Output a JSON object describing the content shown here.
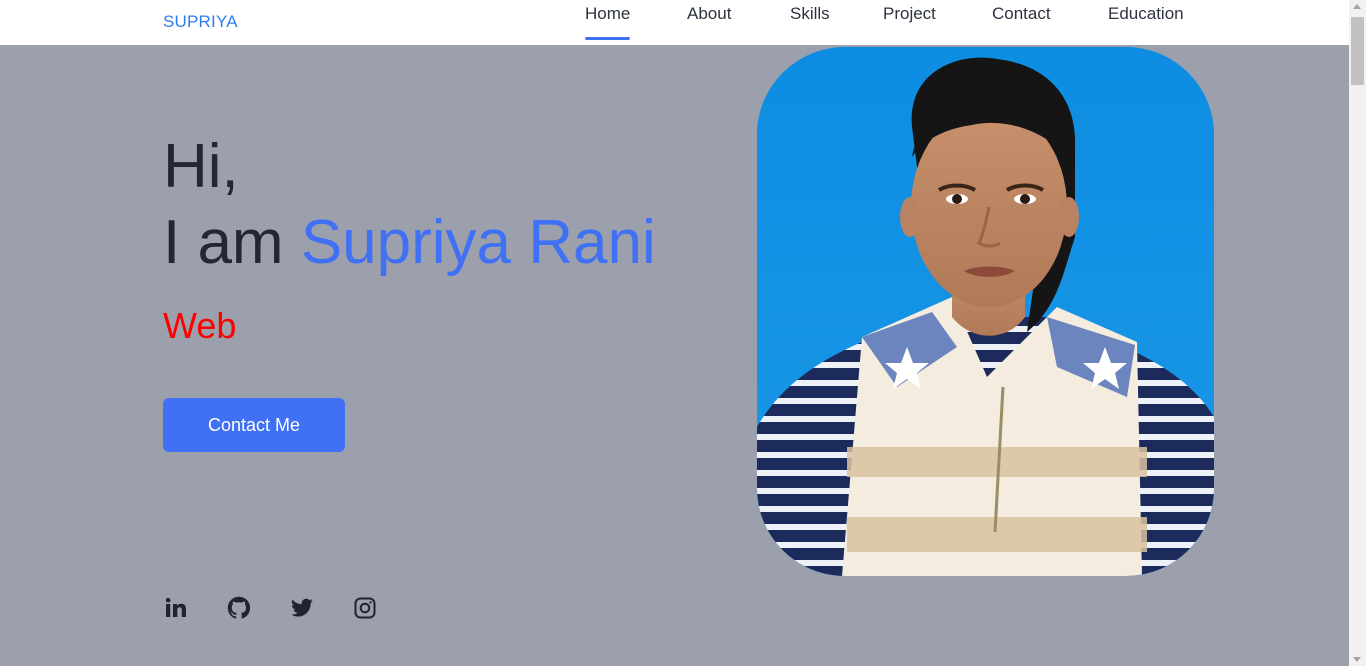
{
  "nav": {
    "brand": "SUPRIYA",
    "items": [
      {
        "label": "Home",
        "active": true
      },
      {
        "label": "About"
      },
      {
        "label": "Skills"
      },
      {
        "label": "Project"
      },
      {
        "label": "Contact"
      },
      {
        "label": "Education"
      }
    ]
  },
  "hero": {
    "greeting": "Hi,",
    "intro_prefix": "I am ",
    "name": "Supriya Rani",
    "role": "Web",
    "contact_button": "Contact Me"
  },
  "social": [
    {
      "icon": "linkedin-icon"
    },
    {
      "icon": "github-icon"
    },
    {
      "icon": "twitter-icon"
    },
    {
      "icon": "instagram-icon"
    }
  ],
  "colors": {
    "accent": "#4070f4",
    "brand": "#2f7cf6",
    "role": "#ff0000",
    "background": "#9ca0ac",
    "photo_background": "#1190e0"
  }
}
